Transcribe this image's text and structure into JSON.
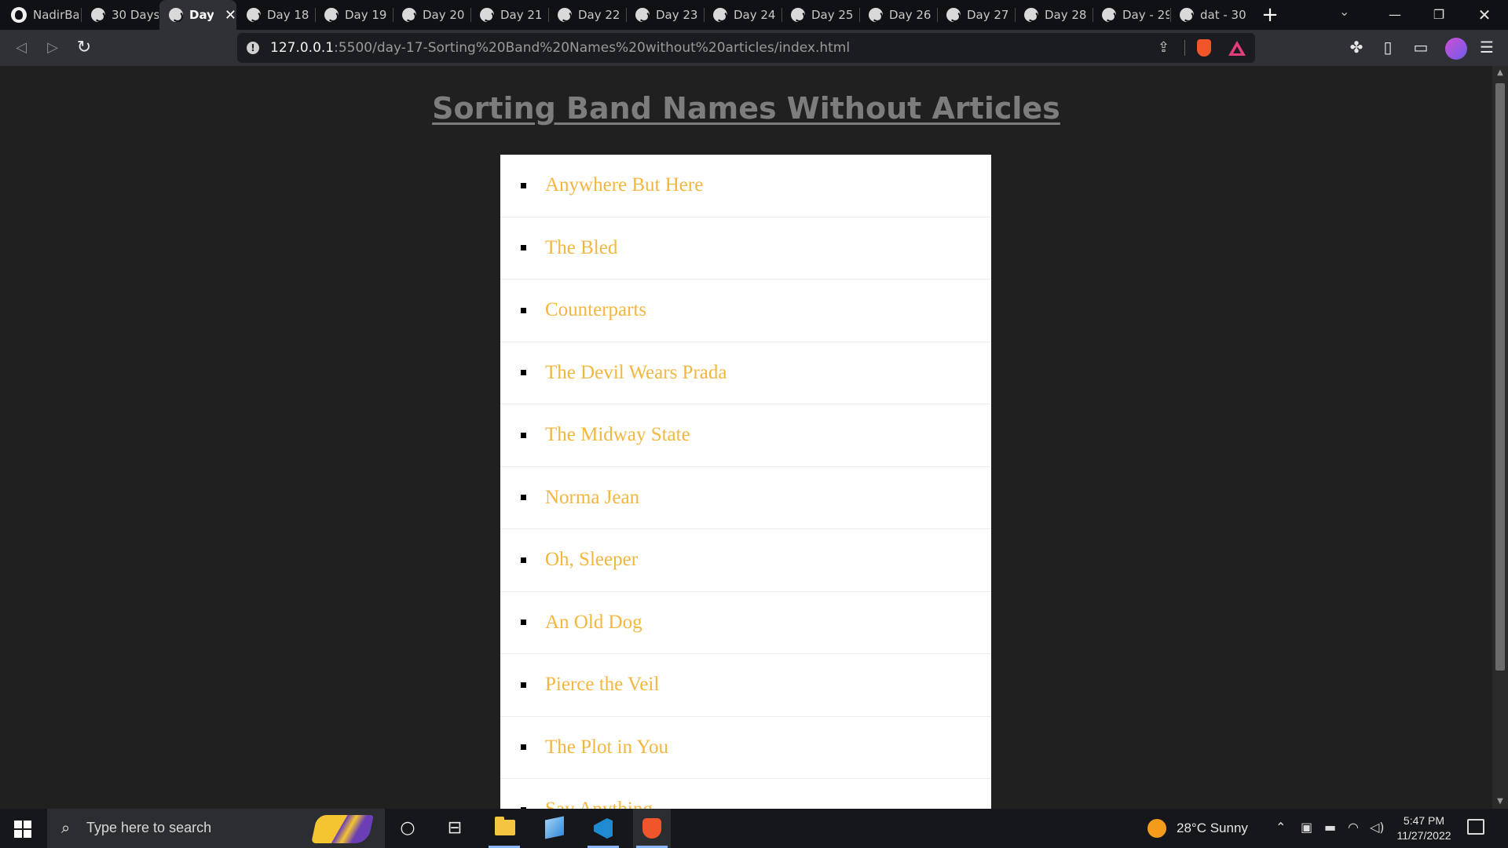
{
  "browser": {
    "tabs": [
      {
        "title": "NadirBa",
        "icon": "github-icon",
        "active": false
      },
      {
        "title": "30 Days",
        "icon": "globe-icon",
        "active": false
      },
      {
        "title": "Day",
        "icon": "globe-icon",
        "active": true
      },
      {
        "title": "Day 18",
        "icon": "globe-icon",
        "active": false
      },
      {
        "title": "Day 19",
        "icon": "globe-icon",
        "active": false
      },
      {
        "title": "Day 20",
        "icon": "globe-icon",
        "active": false
      },
      {
        "title": "Day 21",
        "icon": "globe-icon",
        "active": false
      },
      {
        "title": "Day 22",
        "icon": "globe-icon",
        "active": false
      },
      {
        "title": "Day 23",
        "icon": "globe-icon",
        "active": false
      },
      {
        "title": "Day 24",
        "icon": "globe-icon",
        "active": false
      },
      {
        "title": "Day 25",
        "icon": "globe-icon",
        "active": false
      },
      {
        "title": "Day 26",
        "icon": "globe-icon",
        "active": false
      },
      {
        "title": "Day 27",
        "icon": "globe-icon",
        "active": false
      },
      {
        "title": "Day 28",
        "icon": "globe-icon",
        "active": false
      },
      {
        "title": "Day - 29",
        "icon": "globe-icon",
        "active": false
      },
      {
        "title": "dat - 30",
        "icon": "globe-icon",
        "active": false
      }
    ],
    "new_tab_label": "+",
    "address": {
      "host": "127.0.0.1",
      "path": ":5500/day-17-Sorting%20Band%20Names%20without%20articles/index.html"
    }
  },
  "page": {
    "title": "Sorting Band Names Without Articles",
    "bands": [
      "Anywhere But Here",
      "The Bled",
      "Counterparts",
      "The Devil Wears Prada",
      "The Midway State",
      "Norma Jean",
      "Oh, Sleeper",
      "An Old Dog",
      "Pierce the Veil",
      "The Plot in You",
      "Say Anything"
    ],
    "colors": {
      "background": "#202020",
      "title": "#7d7d7d",
      "list_background": "#ffffff",
      "band_text": "#f4b63f"
    }
  },
  "taskbar": {
    "search_placeholder": "Type here to search",
    "weather": "28°C  Sunny",
    "time": "5:47 PM",
    "date": "11/27/2022"
  }
}
